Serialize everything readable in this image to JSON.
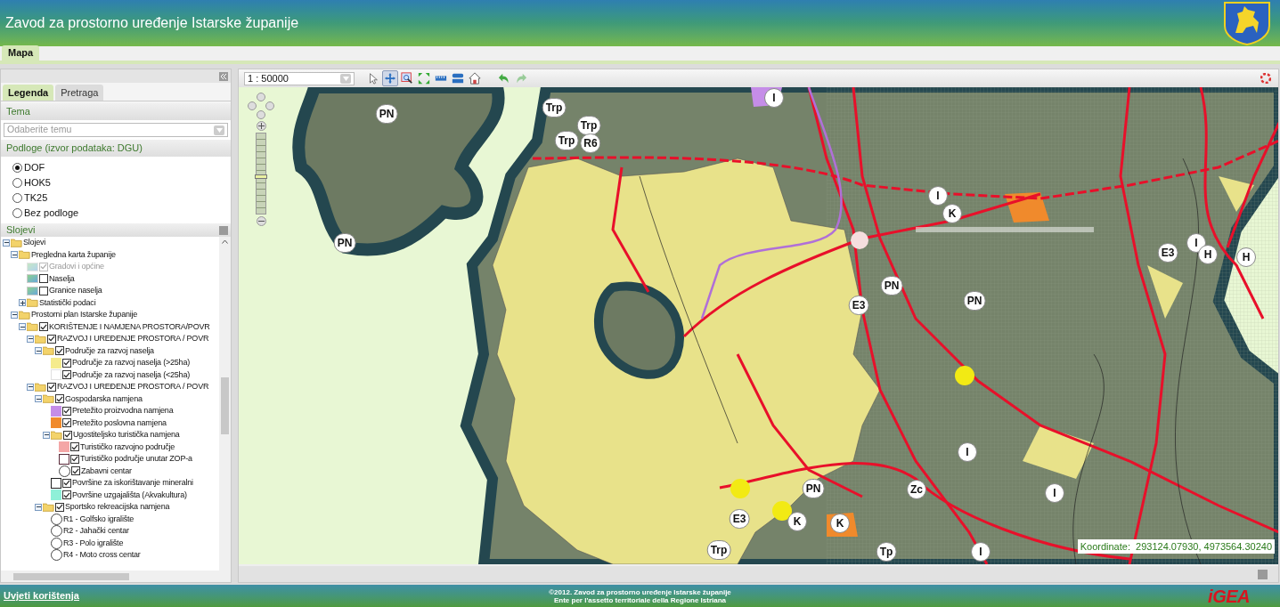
{
  "header": {
    "title": "Zavod za prostorno uređenje Istarske županije"
  },
  "main_tabs": [
    {
      "label": "Mapa",
      "selected": true
    }
  ],
  "left_panel": {
    "tabs": [
      {
        "label": "Legenda",
        "selected": true
      },
      {
        "label": "Pretraga",
        "selected": false
      }
    ],
    "tema": {
      "title": "Tema",
      "placeholder": "Odaberite temu"
    },
    "podloge": {
      "title": "Podloge (izvor podataka: DGU)",
      "options": [
        {
          "label": "DOF",
          "selected": true
        },
        {
          "label": "HOK5",
          "selected": false
        },
        {
          "label": "TK25",
          "selected": false
        },
        {
          "label": "Bez podloge",
          "selected": false
        }
      ]
    },
    "slojevi": {
      "title": "Slojevi",
      "tree": [
        {
          "label": "Slojevi",
          "kind": "folder",
          "expanded": true,
          "children": [
            {
              "label": "Pregledna karta županije",
              "kind": "folder",
              "expanded": true,
              "children": [
                {
                  "label": "Gradovi i općine",
                  "kind": "map",
                  "checked": true,
                  "disabled": true
                },
                {
                  "label": "Naselja",
                  "kind": "map",
                  "checked": false,
                  "disabled": false
                },
                {
                  "label": "Granice naselja",
                  "kind": "map",
                  "checked": false,
                  "disabled": false
                },
                {
                  "label": "Statistički podaci",
                  "kind": "folder",
                  "expanded": false
                }
              ]
            },
            {
              "label": "Prostorni plan Istarske županije",
              "kind": "folder",
              "expanded": true,
              "children": [
                {
                  "label": "KORIŠTENJE I NAMJENA PROSTORA/POVR",
                  "kind": "folder",
                  "expanded": true,
                  "checked": true,
                  "children": [
                    {
                      "label": "RAZVOJ I UREĐENJE PROSTORA / POVR",
                      "kind": "folder",
                      "expanded": true,
                      "checked": true,
                      "children": [
                        {
                          "label": "Područje za razvoj naselja",
                          "kind": "folder",
                          "expanded": true,
                          "checked": true,
                          "children": [
                            {
                              "label": "Područje za razvoj naselja (>25ha)",
                              "kind": "swatch",
                              "color": "#f5eb8c",
                              "checked": true
                            },
                            {
                              "label": "Područje za razvoj naselja (<25ha)",
                              "kind": "outline",
                              "color": "#e0e0e0",
                              "checked": true
                            }
                          ]
                        }
                      ]
                    },
                    {
                      "label": "RAZVOJ I UREĐENJE PROSTORA / POVR",
                      "kind": "folder",
                      "expanded": true,
                      "checked": true,
                      "children": [
                        {
                          "label": "Gospodarska namjena",
                          "kind": "folder",
                          "expanded": true,
                          "checked": true,
                          "children": [
                            {
                              "label": "Pretežito proizvodna namjena",
                              "kind": "swatch",
                              "color": "#c58de8",
                              "checked": true
                            },
                            {
                              "label": "Pretežito poslovna namjena",
                              "kind": "swatch",
                              "color": "#f08a2c",
                              "checked": true
                            },
                            {
                              "label": "Ugostiteljsko turistička namjena",
                              "kind": "folder",
                              "expanded": true,
                              "checked": true,
                              "children": [
                                {
                                  "label": "Turističko razvojno područje",
                                  "kind": "swatch",
                                  "color": "#f4a6a6",
                                  "checked": true
                                },
                                {
                                  "label": "Turističko područje unutar ZOP-a",
                                  "kind": "outline",
                                  "color": "#5a2a3a",
                                  "checked": true
                                },
                                {
                                  "label": "Zabavni centar",
                                  "kind": "circle",
                                  "checked": true
                                }
                              ]
                            },
                            {
                              "label": "Površine za iskorištavanje mineralni",
                              "kind": "outline",
                              "color": "#202020",
                              "checked": true
                            },
                            {
                              "label": "Površine uzgajališta (Akvakultura)",
                              "kind": "swatch",
                              "color": "#8ff0d8",
                              "checked": true
                            }
                          ]
                        },
                        {
                          "label": "Sportsko rekreacijska namjena",
                          "kind": "folder",
                          "expanded": true,
                          "checked": true,
                          "children": [
                            {
                              "label": "R1 - Golfsko igralište",
                              "kind": "circle"
                            },
                            {
                              "label": "R2 - Jahački centar",
                              "kind": "circle"
                            },
                            {
                              "label": "R3 - Polo igralište",
                              "kind": "circle"
                            },
                            {
                              "label": "R4 - Moto cross centar",
                              "kind": "circle"
                            }
                          ]
                        }
                      ]
                    }
                  ]
                }
              ]
            }
          ]
        }
      ]
    }
  },
  "map": {
    "scale": "1 : 50000",
    "tools": [
      {
        "kind": "select",
        "selected": false
      },
      {
        "kind": "pan",
        "selected": true
      },
      {
        "kind": "zoombox",
        "selected": false
      },
      {
        "kind": "extent",
        "selected": false
      },
      {
        "kind": "measure-line",
        "selected": false
      },
      {
        "kind": "measure-area",
        "selected": false
      },
      {
        "kind": "home",
        "selected": false
      },
      {
        "kind": "undo",
        "selected": false
      },
      {
        "kind": "redo",
        "selected": false
      }
    ],
    "zoom_slider": {
      "level": 0.45
    },
    "markers": [
      {
        "label": "PN"
      },
      {
        "label": "Trp"
      },
      {
        "label": "Trp"
      },
      {
        "label": "Trp"
      },
      {
        "label": "R6"
      },
      {
        "label": "I"
      },
      {
        "label": "PN"
      },
      {
        "label": "I"
      },
      {
        "label": "K"
      },
      {
        "label": "E3"
      },
      {
        "label": "I"
      },
      {
        "label": "H"
      },
      {
        "label": "H"
      },
      {
        "label": "PN"
      },
      {
        "label": "E3"
      },
      {
        "label": "PN"
      },
      {
        "label": "I"
      },
      {
        "label": "Zc"
      },
      {
        "label": "I"
      },
      {
        "label": "PN"
      },
      {
        "label": "E3"
      },
      {
        "label": "K"
      },
      {
        "label": "K"
      },
      {
        "label": "Trp"
      },
      {
        "label": "Tp"
      },
      {
        "label": "I"
      }
    ],
    "coordinates": "Koordinate:  293124.07930, 4973564.30240"
  },
  "footer": {
    "link": "Uvjeti korištenja",
    "copyright": [
      "©2012. Zavod za prostorno uređenje Istarske županije",
      "Ente per l'assetto territoriale della Regione Istriana"
    ],
    "logo": "iGEA"
  }
}
